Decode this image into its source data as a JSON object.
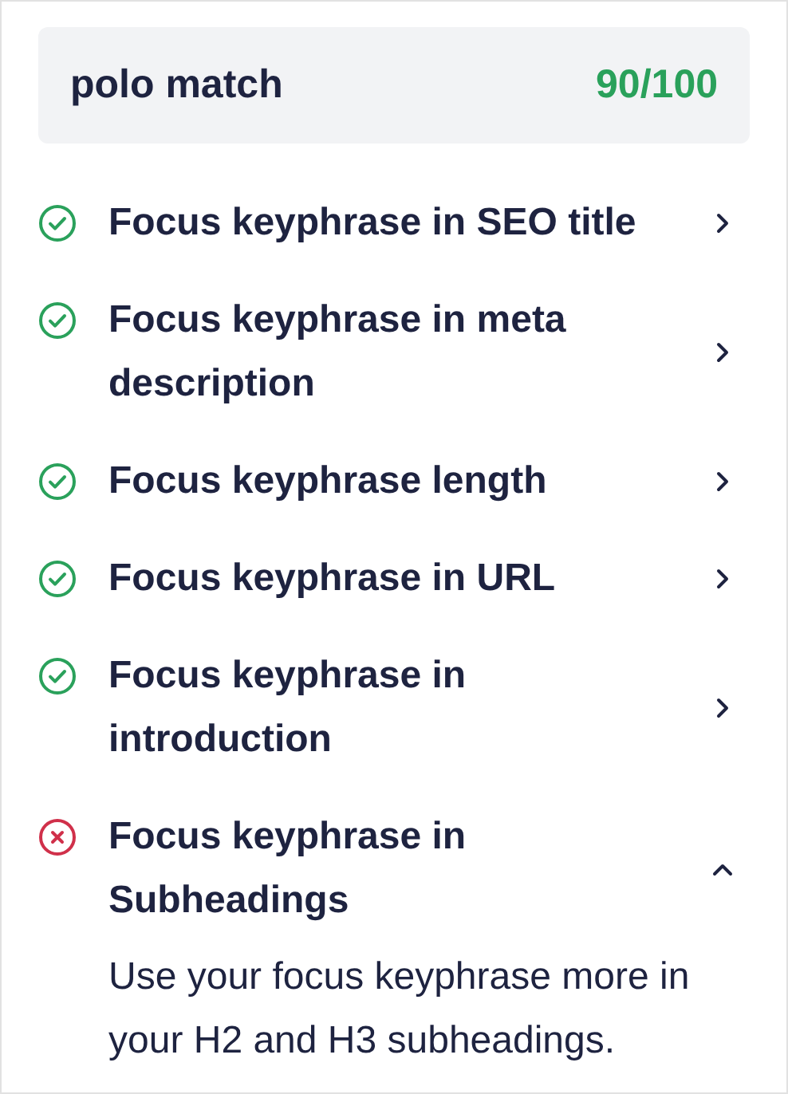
{
  "keyphrase": {
    "text": "polo match",
    "score": "90/100"
  },
  "checks": [
    {
      "kind": "good",
      "label": "Focus keyphrase in SEO title",
      "expanded": false
    },
    {
      "kind": "good",
      "label": "Focus keyphrase in meta description",
      "expanded": false
    },
    {
      "kind": "good",
      "label": "Focus keyphrase length",
      "expanded": false
    },
    {
      "kind": "good",
      "label": "Focus keyphrase in URL",
      "expanded": false
    },
    {
      "kind": "good",
      "label": "Focus keyphrase in introduction",
      "expanded": false
    },
    {
      "kind": "bad",
      "label": "Focus keyphrase in Subheadings",
      "expanded": true,
      "description": "Use your focus keyphrase more in your H2 and H3 subheadings."
    }
  ]
}
